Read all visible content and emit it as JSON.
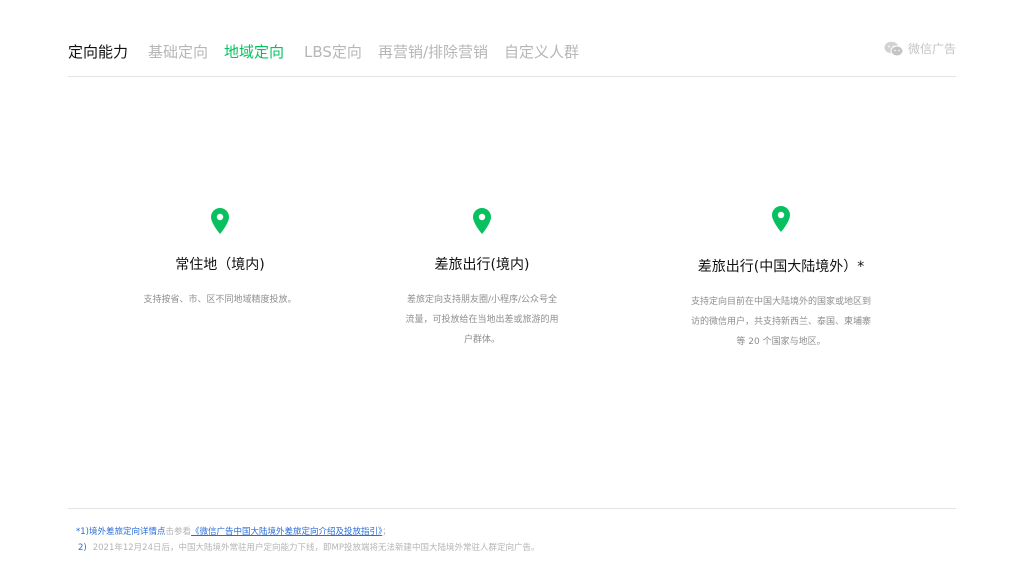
{
  "header": {
    "title": "定向能力",
    "tabs": [
      {
        "label": "基础定向",
        "active": false
      },
      {
        "label": "地域定向",
        "active": true
      },
      {
        "label": "LBS定向",
        "active": false
      },
      {
        "label": "再营销/排除营销",
        "active": false
      },
      {
        "label": "自定义人群",
        "active": false
      }
    ],
    "brand": "微信广告"
  },
  "cards": [
    {
      "title": "常住地（境内)",
      "desc": "支持按省、市、区不同地域精度投放。"
    },
    {
      "title": "差旅出行(境内)",
      "desc": "差旅定向支持朋友圈/小程序/公众号全流量，可投放给在当地出差或旅游的用户群体。"
    },
    {
      "title": "差旅出行(中国大陆境外）*",
      "desc": "支持定向目前在中国大陆境外的国家或地区到访的微信用户，共支持新西兰、泰国、柬埔寨等 20 个国家与地区。"
    }
  ],
  "footer": {
    "note1_prefix": "*1)境外差旅定向详情点",
    "note1_mid": "击参看",
    "note1_link": "《微信广告中国大陆境外差旅定向介绍及投放指引》",
    "note1_suffix": "；",
    "note2_num": "2)",
    "note2_text": "2021年12月24日后，中国大陆境外常驻用户定向能力下线，即MP投放端将无法新建中国大陆境外常驻人群定向广告。"
  },
  "colors": {
    "accent": "#07c160",
    "link": "#2b6dd6"
  }
}
